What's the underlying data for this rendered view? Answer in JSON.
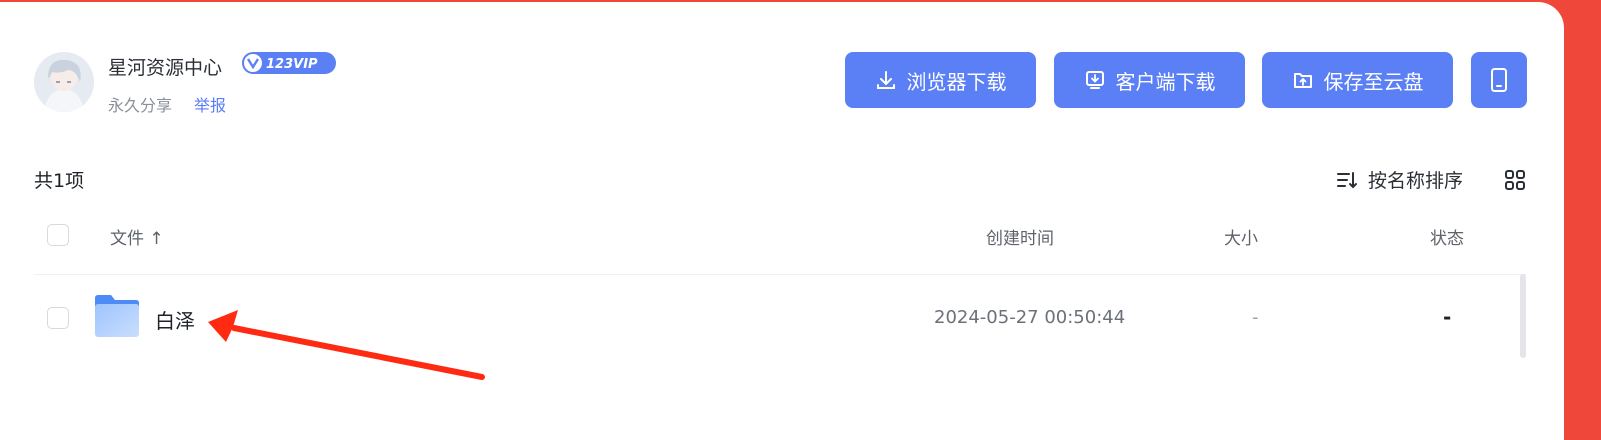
{
  "header": {
    "user_name": "星河资源中心",
    "vip_badge": "123VIP",
    "share_type": "永久分享",
    "report_link": "举报"
  },
  "actions": {
    "browser_download": "浏览器下载",
    "client_download": "客户端下载",
    "save_to_cloud": "保存至云盘",
    "mobile_icon": "mobile-phone-icon"
  },
  "list": {
    "count_label": "共1项",
    "sort_label": "按名称排序",
    "columns": {
      "file": "文件 ↑",
      "created": "创建时间",
      "size": "大小",
      "status": "状态"
    },
    "rows": [
      {
        "name": "白泽",
        "created": "2024-05-27 00:50:44",
        "size": "-",
        "status": "-"
      }
    ]
  },
  "colors": {
    "accent": "#5b7ff5",
    "background_frame": "#f0473b",
    "annotation_arrow": "#ff2a12"
  }
}
